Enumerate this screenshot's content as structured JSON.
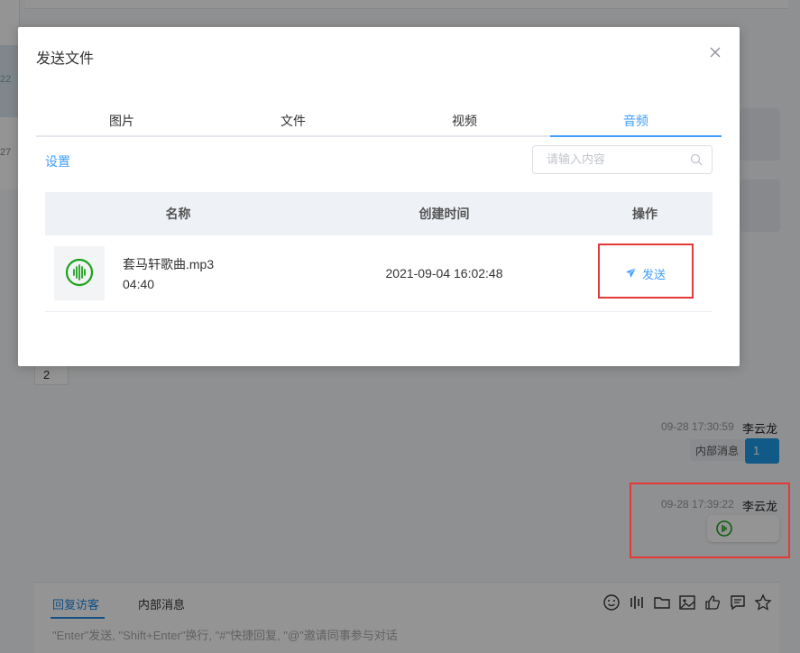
{
  "modal": {
    "title": "发送文件",
    "tabs": [
      {
        "label": "图片",
        "active": false
      },
      {
        "label": "文件",
        "active": false
      },
      {
        "label": "视频",
        "active": false
      },
      {
        "label": "音频",
        "active": true
      }
    ],
    "settings_label": "设置",
    "search_placeholder": "请输入内容",
    "table": {
      "headers": [
        "名称",
        "创建时间",
        "操作"
      ],
      "rows": [
        {
          "icon": "audio-wave-icon",
          "name": "套马轩歌曲.mp3",
          "duration": "04:40",
          "created": "2021-09-04 16:02:48",
          "action": "发送"
        }
      ]
    }
  },
  "background": {
    "left_panel": {
      "t1": "22",
      "t2": "27"
    },
    "badge_number": "2",
    "messages": [
      {
        "time": "09-28 17:30:59",
        "user": "李云龙",
        "tag": "内部消息",
        "content": "1"
      },
      {
        "time": "09-28 17:39:22",
        "user": "李云龙",
        "content_icon": "audio-play-icon"
      }
    ],
    "composer": {
      "tab_reply": "回复访客",
      "tab_internal": "内部消息",
      "hint": "\"Enter\"发送, \"Shift+Enter\"换行, \"#\"快捷回复, \"@\"邀请同事参与对话"
    }
  },
  "colors": {
    "accent": "#409eff",
    "highlight": "#e53935",
    "audio_green": "#1aa31a"
  }
}
